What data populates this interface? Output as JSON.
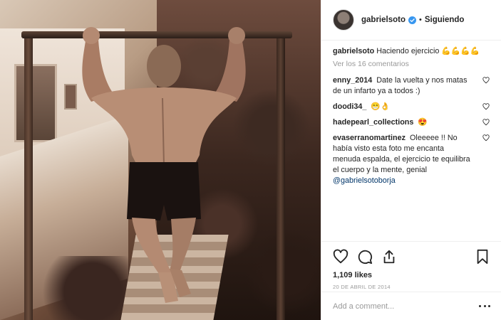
{
  "post": {
    "username": "gabrielsoto",
    "follow_status": "Siguiendo",
    "separator": "•",
    "caption_user": "gabrielsoto",
    "caption_text": "Haciendo ejercicio 💪💪💪💪",
    "view_comments_prefix": "Ver los ",
    "view_comments_count": "16",
    "view_comments_suffix": " comentarios",
    "comments": [
      {
        "user": "enny_2014",
        "text": "Date la vuelta y nos matas de un infarto ya a todos :)",
        "mention": ""
      },
      {
        "user": "doodi34_",
        "text": "😁👌",
        "mention": ""
      },
      {
        "user": "hadepearl_collections",
        "text": "😍",
        "mention": ""
      },
      {
        "user": "evaserranomartinez",
        "text": "Oleeeee !! No había visto esta foto me encanta menuda espalda, el ejercicio te equilibra el cuerpo y la mente, genial",
        "mention": "@gabrielsotoborja"
      }
    ],
    "likes": "1,109 likes",
    "timestamp": "20 de abril de 2014",
    "add_comment_placeholder": "Add a comment..."
  },
  "icons": {
    "verified": "verified-badge-icon",
    "like": "heart-icon",
    "comment": "comment-bubble-icon",
    "share": "share-upload-icon",
    "save": "bookmark-icon",
    "more": "more-options-icon"
  },
  "colors": {
    "verified_blue": "#3897f0",
    "text": "#262626",
    "muted": "#999999",
    "mention": "#003569",
    "border": "#efefef"
  }
}
